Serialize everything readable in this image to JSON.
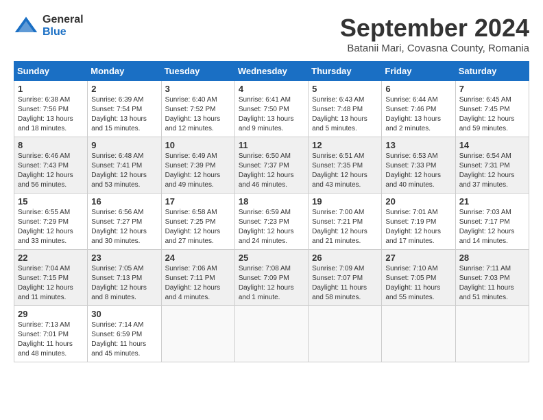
{
  "logo": {
    "general": "General",
    "blue": "Blue"
  },
  "title": {
    "month": "September 2024",
    "location": "Batanii Mari, Covasna County, Romania"
  },
  "headers": [
    "Sunday",
    "Monday",
    "Tuesday",
    "Wednesday",
    "Thursday",
    "Friday",
    "Saturday"
  ],
  "weeks": [
    [
      {
        "day": "1",
        "info": "Sunrise: 6:38 AM\nSunset: 7:56 PM\nDaylight: 13 hours\nand 18 minutes."
      },
      {
        "day": "2",
        "info": "Sunrise: 6:39 AM\nSunset: 7:54 PM\nDaylight: 13 hours\nand 15 minutes."
      },
      {
        "day": "3",
        "info": "Sunrise: 6:40 AM\nSunset: 7:52 PM\nDaylight: 13 hours\nand 12 minutes."
      },
      {
        "day": "4",
        "info": "Sunrise: 6:41 AM\nSunset: 7:50 PM\nDaylight: 13 hours\nand 9 minutes."
      },
      {
        "day": "5",
        "info": "Sunrise: 6:43 AM\nSunset: 7:48 PM\nDaylight: 13 hours\nand 5 minutes."
      },
      {
        "day": "6",
        "info": "Sunrise: 6:44 AM\nSunset: 7:46 PM\nDaylight: 13 hours\nand 2 minutes."
      },
      {
        "day": "7",
        "info": "Sunrise: 6:45 AM\nSunset: 7:45 PM\nDaylight: 12 hours\nand 59 minutes."
      }
    ],
    [
      {
        "day": "8",
        "info": "Sunrise: 6:46 AM\nSunset: 7:43 PM\nDaylight: 12 hours\nand 56 minutes."
      },
      {
        "day": "9",
        "info": "Sunrise: 6:48 AM\nSunset: 7:41 PM\nDaylight: 12 hours\nand 53 minutes."
      },
      {
        "day": "10",
        "info": "Sunrise: 6:49 AM\nSunset: 7:39 PM\nDaylight: 12 hours\nand 49 minutes."
      },
      {
        "day": "11",
        "info": "Sunrise: 6:50 AM\nSunset: 7:37 PM\nDaylight: 12 hours\nand 46 minutes."
      },
      {
        "day": "12",
        "info": "Sunrise: 6:51 AM\nSunset: 7:35 PM\nDaylight: 12 hours\nand 43 minutes."
      },
      {
        "day": "13",
        "info": "Sunrise: 6:53 AM\nSunset: 7:33 PM\nDaylight: 12 hours\nand 40 minutes."
      },
      {
        "day": "14",
        "info": "Sunrise: 6:54 AM\nSunset: 7:31 PM\nDaylight: 12 hours\nand 37 minutes."
      }
    ],
    [
      {
        "day": "15",
        "info": "Sunrise: 6:55 AM\nSunset: 7:29 PM\nDaylight: 12 hours\nand 33 minutes."
      },
      {
        "day": "16",
        "info": "Sunrise: 6:56 AM\nSunset: 7:27 PM\nDaylight: 12 hours\nand 30 minutes."
      },
      {
        "day": "17",
        "info": "Sunrise: 6:58 AM\nSunset: 7:25 PM\nDaylight: 12 hours\nand 27 minutes."
      },
      {
        "day": "18",
        "info": "Sunrise: 6:59 AM\nSunset: 7:23 PM\nDaylight: 12 hours\nand 24 minutes."
      },
      {
        "day": "19",
        "info": "Sunrise: 7:00 AM\nSunset: 7:21 PM\nDaylight: 12 hours\nand 21 minutes."
      },
      {
        "day": "20",
        "info": "Sunrise: 7:01 AM\nSunset: 7:19 PM\nDaylight: 12 hours\nand 17 minutes."
      },
      {
        "day": "21",
        "info": "Sunrise: 7:03 AM\nSunset: 7:17 PM\nDaylight: 12 hours\nand 14 minutes."
      }
    ],
    [
      {
        "day": "22",
        "info": "Sunrise: 7:04 AM\nSunset: 7:15 PM\nDaylight: 12 hours\nand 11 minutes."
      },
      {
        "day": "23",
        "info": "Sunrise: 7:05 AM\nSunset: 7:13 PM\nDaylight: 12 hours\nand 8 minutes."
      },
      {
        "day": "24",
        "info": "Sunrise: 7:06 AM\nSunset: 7:11 PM\nDaylight: 12 hours\nand 4 minutes."
      },
      {
        "day": "25",
        "info": "Sunrise: 7:08 AM\nSunset: 7:09 PM\nDaylight: 12 hours\nand 1 minute."
      },
      {
        "day": "26",
        "info": "Sunrise: 7:09 AM\nSunset: 7:07 PM\nDaylight: 11 hours\nand 58 minutes."
      },
      {
        "day": "27",
        "info": "Sunrise: 7:10 AM\nSunset: 7:05 PM\nDaylight: 11 hours\nand 55 minutes."
      },
      {
        "day": "28",
        "info": "Sunrise: 7:11 AM\nSunset: 7:03 PM\nDaylight: 11 hours\nand 51 minutes."
      }
    ],
    [
      {
        "day": "29",
        "info": "Sunrise: 7:13 AM\nSunset: 7:01 PM\nDaylight: 11 hours\nand 48 minutes."
      },
      {
        "day": "30",
        "info": "Sunrise: 7:14 AM\nSunset: 6:59 PM\nDaylight: 11 hours\nand 45 minutes."
      },
      {
        "day": "",
        "info": ""
      },
      {
        "day": "",
        "info": ""
      },
      {
        "day": "",
        "info": ""
      },
      {
        "day": "",
        "info": ""
      },
      {
        "day": "",
        "info": ""
      }
    ]
  ]
}
